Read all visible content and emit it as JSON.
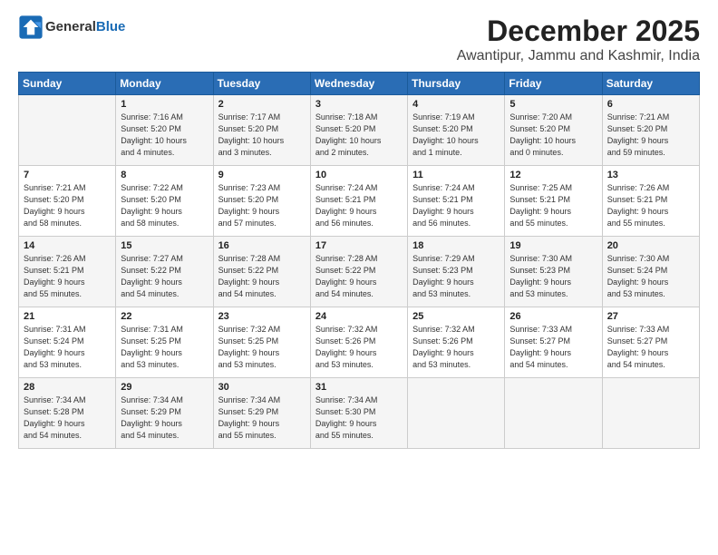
{
  "logo": {
    "general": "General",
    "blue": "Blue"
  },
  "header": {
    "month": "December 2025",
    "location": "Awantipur, Jammu and Kashmir, India"
  },
  "columns": [
    "Sunday",
    "Monday",
    "Tuesday",
    "Wednesday",
    "Thursday",
    "Friday",
    "Saturday"
  ],
  "weeks": [
    [
      {
        "day": "",
        "info": ""
      },
      {
        "day": "1",
        "info": "Sunrise: 7:16 AM\nSunset: 5:20 PM\nDaylight: 10 hours\nand 4 minutes."
      },
      {
        "day": "2",
        "info": "Sunrise: 7:17 AM\nSunset: 5:20 PM\nDaylight: 10 hours\nand 3 minutes."
      },
      {
        "day": "3",
        "info": "Sunrise: 7:18 AM\nSunset: 5:20 PM\nDaylight: 10 hours\nand 2 minutes."
      },
      {
        "day": "4",
        "info": "Sunrise: 7:19 AM\nSunset: 5:20 PM\nDaylight: 10 hours\nand 1 minute."
      },
      {
        "day": "5",
        "info": "Sunrise: 7:20 AM\nSunset: 5:20 PM\nDaylight: 10 hours\nand 0 minutes."
      },
      {
        "day": "6",
        "info": "Sunrise: 7:21 AM\nSunset: 5:20 PM\nDaylight: 9 hours\nand 59 minutes."
      }
    ],
    [
      {
        "day": "7",
        "info": "Sunrise: 7:21 AM\nSunset: 5:20 PM\nDaylight: 9 hours\nand 58 minutes."
      },
      {
        "day": "8",
        "info": "Sunrise: 7:22 AM\nSunset: 5:20 PM\nDaylight: 9 hours\nand 58 minutes."
      },
      {
        "day": "9",
        "info": "Sunrise: 7:23 AM\nSunset: 5:20 PM\nDaylight: 9 hours\nand 57 minutes."
      },
      {
        "day": "10",
        "info": "Sunrise: 7:24 AM\nSunset: 5:21 PM\nDaylight: 9 hours\nand 56 minutes."
      },
      {
        "day": "11",
        "info": "Sunrise: 7:24 AM\nSunset: 5:21 PM\nDaylight: 9 hours\nand 56 minutes."
      },
      {
        "day": "12",
        "info": "Sunrise: 7:25 AM\nSunset: 5:21 PM\nDaylight: 9 hours\nand 55 minutes."
      },
      {
        "day": "13",
        "info": "Sunrise: 7:26 AM\nSunset: 5:21 PM\nDaylight: 9 hours\nand 55 minutes."
      }
    ],
    [
      {
        "day": "14",
        "info": "Sunrise: 7:26 AM\nSunset: 5:21 PM\nDaylight: 9 hours\nand 55 minutes."
      },
      {
        "day": "15",
        "info": "Sunrise: 7:27 AM\nSunset: 5:22 PM\nDaylight: 9 hours\nand 54 minutes."
      },
      {
        "day": "16",
        "info": "Sunrise: 7:28 AM\nSunset: 5:22 PM\nDaylight: 9 hours\nand 54 minutes."
      },
      {
        "day": "17",
        "info": "Sunrise: 7:28 AM\nSunset: 5:22 PM\nDaylight: 9 hours\nand 54 minutes."
      },
      {
        "day": "18",
        "info": "Sunrise: 7:29 AM\nSunset: 5:23 PM\nDaylight: 9 hours\nand 53 minutes."
      },
      {
        "day": "19",
        "info": "Sunrise: 7:30 AM\nSunset: 5:23 PM\nDaylight: 9 hours\nand 53 minutes."
      },
      {
        "day": "20",
        "info": "Sunrise: 7:30 AM\nSunset: 5:24 PM\nDaylight: 9 hours\nand 53 minutes."
      }
    ],
    [
      {
        "day": "21",
        "info": "Sunrise: 7:31 AM\nSunset: 5:24 PM\nDaylight: 9 hours\nand 53 minutes."
      },
      {
        "day": "22",
        "info": "Sunrise: 7:31 AM\nSunset: 5:25 PM\nDaylight: 9 hours\nand 53 minutes."
      },
      {
        "day": "23",
        "info": "Sunrise: 7:32 AM\nSunset: 5:25 PM\nDaylight: 9 hours\nand 53 minutes."
      },
      {
        "day": "24",
        "info": "Sunrise: 7:32 AM\nSunset: 5:26 PM\nDaylight: 9 hours\nand 53 minutes."
      },
      {
        "day": "25",
        "info": "Sunrise: 7:32 AM\nSunset: 5:26 PM\nDaylight: 9 hours\nand 53 minutes."
      },
      {
        "day": "26",
        "info": "Sunrise: 7:33 AM\nSunset: 5:27 PM\nDaylight: 9 hours\nand 54 minutes."
      },
      {
        "day": "27",
        "info": "Sunrise: 7:33 AM\nSunset: 5:27 PM\nDaylight: 9 hours\nand 54 minutes."
      }
    ],
    [
      {
        "day": "28",
        "info": "Sunrise: 7:34 AM\nSunset: 5:28 PM\nDaylight: 9 hours\nand 54 minutes."
      },
      {
        "day": "29",
        "info": "Sunrise: 7:34 AM\nSunset: 5:29 PM\nDaylight: 9 hours\nand 54 minutes."
      },
      {
        "day": "30",
        "info": "Sunrise: 7:34 AM\nSunset: 5:29 PM\nDaylight: 9 hours\nand 55 minutes."
      },
      {
        "day": "31",
        "info": "Sunrise: 7:34 AM\nSunset: 5:30 PM\nDaylight: 9 hours\nand 55 minutes."
      },
      {
        "day": "",
        "info": ""
      },
      {
        "day": "",
        "info": ""
      },
      {
        "day": "",
        "info": ""
      }
    ]
  ]
}
